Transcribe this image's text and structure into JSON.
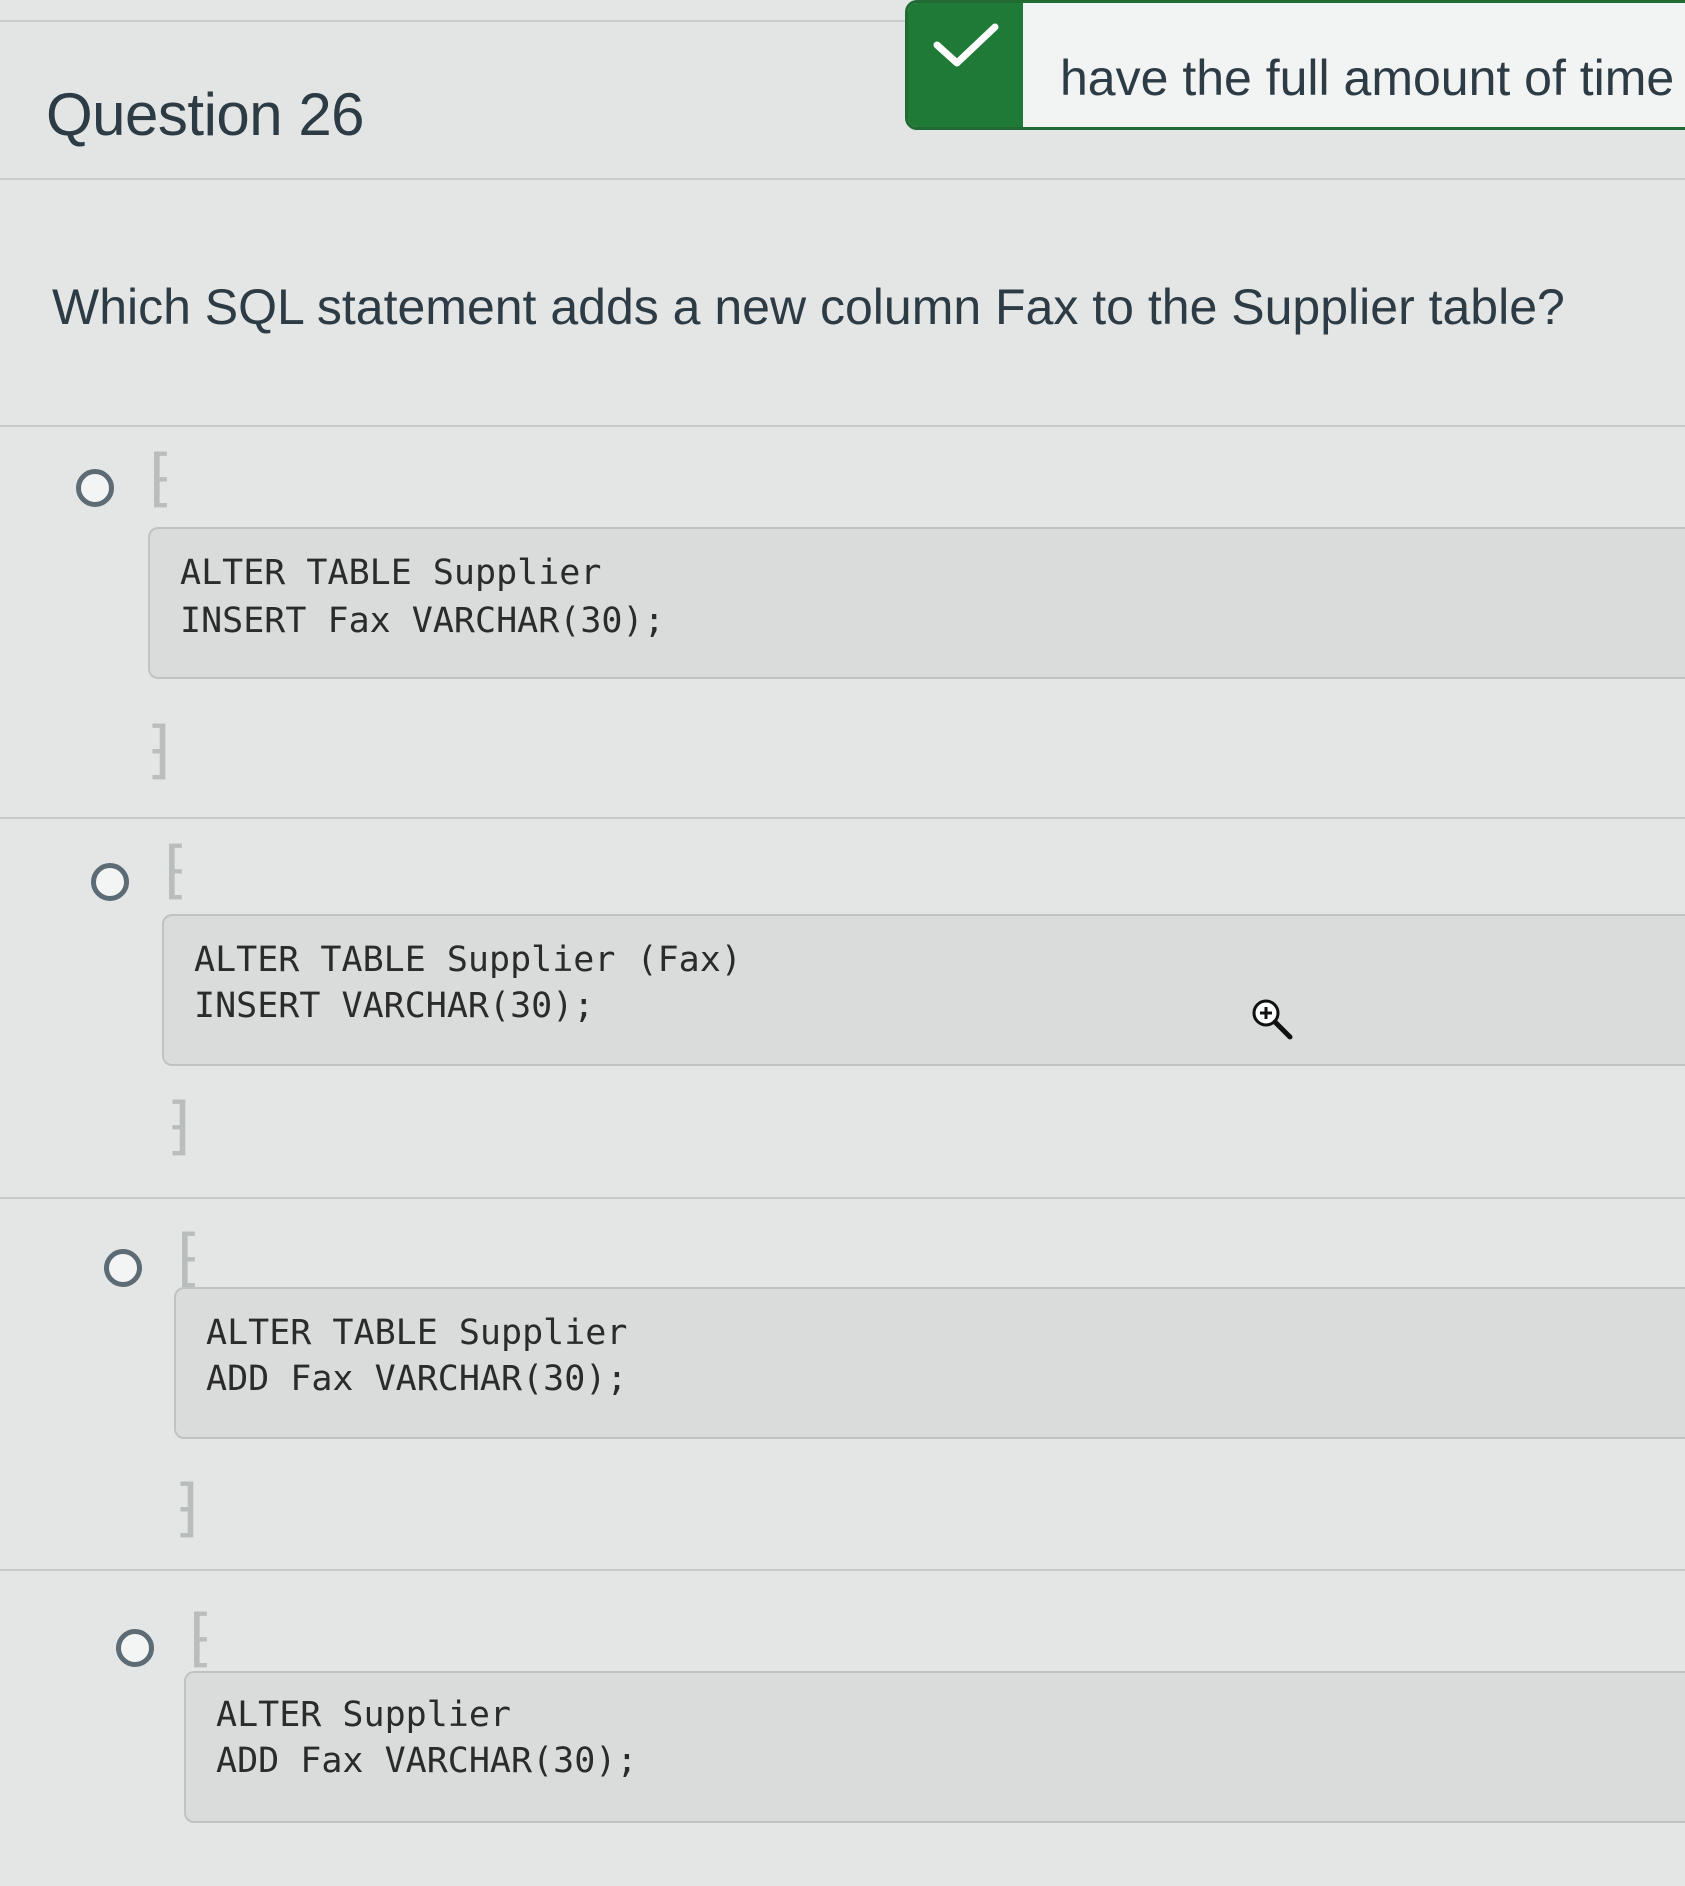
{
  "header": {
    "title": "Question 26",
    "timer_notice": "have the full amount of time t"
  },
  "question": {
    "text": "Which SQL statement adds a new column Fax to the Supplier table?"
  },
  "answers": [
    {
      "line1": "ALTER TABLE Supplier",
      "line2": "INSERT Fax VARCHAR(30);"
    },
    {
      "line1": "ALTER TABLE Supplier (Fax)",
      "line2": "INSERT VARCHAR(30);"
    },
    {
      "line1": "ALTER TABLE Supplier",
      "line2": "ADD Fax VARCHAR(30);"
    },
    {
      "line1": "ALTER Supplier",
      "line2": "ADD Fax VARCHAR(30);"
    }
  ],
  "icons": {
    "timer": "checkmark-icon",
    "cursor": "zoom-in-cursor-icon"
  },
  "colors": {
    "accent_green": "#1e7a36",
    "text": "#2d3b45",
    "background": "#e4e6e5"
  }
}
